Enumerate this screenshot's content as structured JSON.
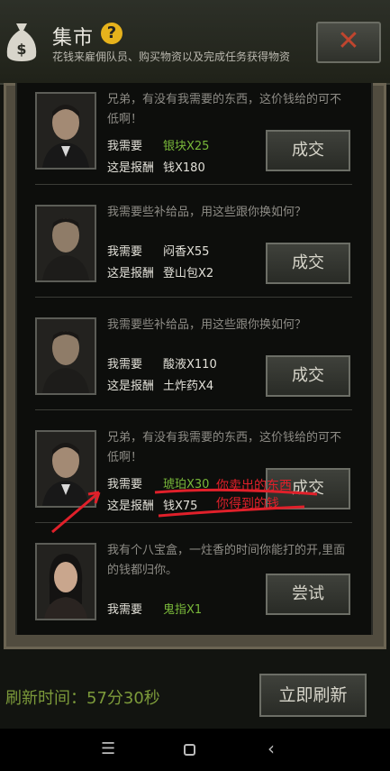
{
  "header": {
    "title": "集市",
    "help_icon": "question-icon",
    "subtitle": "花钱来雇佣队员、购买物资以及完成任务获得物资",
    "close_icon": "close-icon"
  },
  "need_label": "我需要",
  "reward_label": "这是报酬",
  "trades": [
    {
      "quote": "兄弟，有没有我需要的东西，这价钱给的可不低啊！",
      "need": "银块X25",
      "reward": "钱X180",
      "button": "成交"
    },
    {
      "quote": "我需要些补给品，用这些跟你换如何？",
      "need": "闷香X55",
      "reward": "登山包X2",
      "button": "成交"
    },
    {
      "quote": "我需要些补给品，用这些跟你换如何？",
      "need": "酸液X110",
      "reward": "土炸药X4",
      "button": "成交"
    },
    {
      "quote": "兄弟，有没有我需要的东西，这价钱给的可不低啊！",
      "need": "琥珀X30",
      "reward": "钱X75",
      "button": "成交"
    },
    {
      "quote": "我有个八宝盒，一炷香的时间你能打的开,里面的钱都归你。",
      "need": "鬼指X1",
      "button": "尝试"
    }
  ],
  "annotation": {
    "sold": "你卖出的东西",
    "received": "你得到的钱"
  },
  "footer": {
    "refresh_time": "刷新时间：57分30秒",
    "refresh_button": "立即刷新"
  },
  "colors": {
    "accent_green": "#79b83a",
    "annotation_red": "#e0202a",
    "close_red": "#c0452e"
  }
}
